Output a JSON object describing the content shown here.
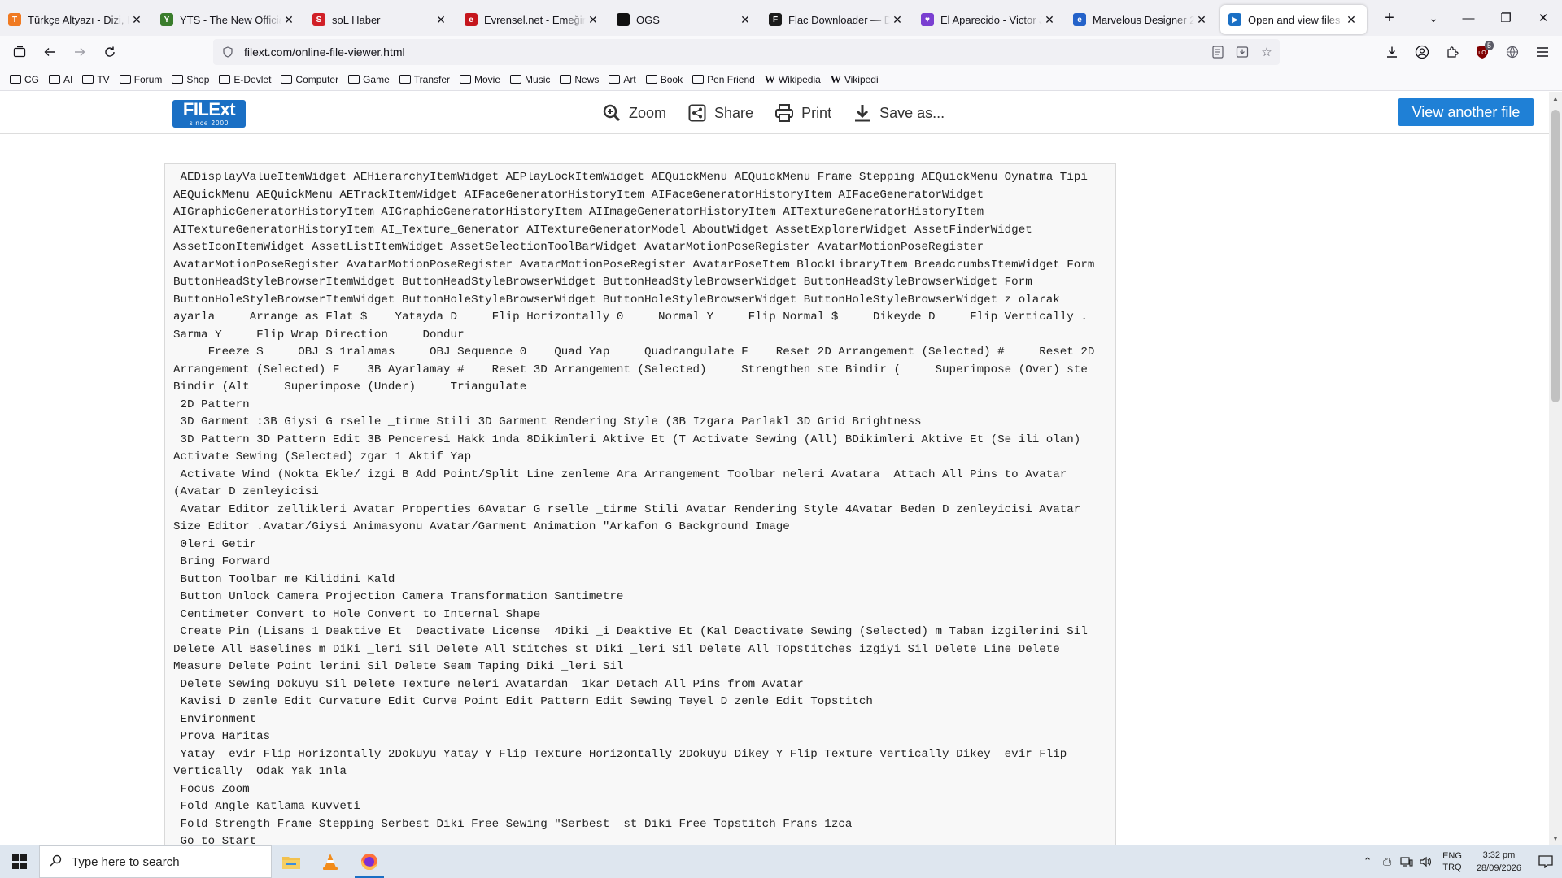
{
  "browser": {
    "tabs": [
      {
        "title": "Türkçe Altyazı - Dizi, Film",
        "favicon_letter": "T",
        "favicon_color": "#f07a22"
      },
      {
        "title": "YTS - The New Official H",
        "favicon_letter": "Y",
        "favicon_color": "#3a7d2c"
      },
      {
        "title": "soL Haber",
        "favicon_letter": "S",
        "favicon_color": "#d12027"
      },
      {
        "title": "Evrensel.net - Emeğin se",
        "favicon_letter": "e",
        "favicon_color": "#c5161d"
      },
      {
        "title": "OGS",
        "favicon_letter": "",
        "favicon_color": "#111111"
      },
      {
        "title": "Flac Downloader — Dow",
        "favicon_letter": "F",
        "favicon_color": "#1b1b1b"
      },
      {
        "title": "El Aparecido - Victor Jar",
        "favicon_letter": "♥",
        "favicon_color": "#7a3fd1"
      },
      {
        "title": "Marvelous Designer 202",
        "favicon_letter": "e",
        "favicon_color": "#2462c9"
      },
      {
        "title": "Open and view files onli",
        "favicon_letter": "▶",
        "favicon_color": "#1a6fc4"
      }
    ],
    "active_tab_index": 8,
    "url": "filext.com/online-file-viewer.html",
    "extension_badge": "5"
  },
  "bookmarks": [
    {
      "label": "CG",
      "type": "folder"
    },
    {
      "label": "AI",
      "type": "folder"
    },
    {
      "label": "TV",
      "type": "folder"
    },
    {
      "label": "Forum",
      "type": "folder"
    },
    {
      "label": "Shop",
      "type": "folder"
    },
    {
      "label": "E-Devlet",
      "type": "folder"
    },
    {
      "label": "Computer",
      "type": "folder"
    },
    {
      "label": "Game",
      "type": "folder"
    },
    {
      "label": "Transfer",
      "type": "folder"
    },
    {
      "label": "Movie",
      "type": "folder"
    },
    {
      "label": "Music",
      "type": "folder"
    },
    {
      "label": "News",
      "type": "folder"
    },
    {
      "label": "Art",
      "type": "folder"
    },
    {
      "label": "Book",
      "type": "folder"
    },
    {
      "label": "Pen Friend",
      "type": "folder"
    },
    {
      "label": "Wikipedia",
      "type": "wiki"
    },
    {
      "label": "Vikipedi",
      "type": "wiki"
    }
  ],
  "site": {
    "logo_text": "FILExt",
    "logo_sub": "since 2000",
    "toolbar": {
      "zoom": "Zoom",
      "share": "Share",
      "print": "Print",
      "save": "Save as..."
    },
    "view_another": "View another file"
  },
  "file_lines": [
    " AEDisplayValueItemWidget AEHierarchyItemWidget AEPlayLockItemWidget AEQuickMenu AEQuickMenu Frame Stepping AEQuickMenu Oynatma Tipi AEQuickMenu AEQuickMenu AETrackItemWidget AIFaceGeneratorHistoryItem AIFaceGeneratorHistoryItem AIFaceGeneratorWidget AIGraphicGeneratorHistoryItem AIGraphicGeneratorHistoryItem AIImageGeneratorHistoryItem AITextureGeneratorHistoryItem AITextureGeneratorHistoryItem AI_Texture_Generator AITextureGeneratorModel AboutWidget AssetExplorerWidget AssetFinderWidget AssetIconItemWidget AssetListItemWidget AssetSelectionToolBarWidget AvatarMotionPoseRegister AvatarMotionPoseRegister AvatarMotionPoseRegister AvatarMotionPoseRegister AvatarMotionPoseRegister AvatarPoseItem BlockLibraryItem BreadcrumbsItemWidget Form  ButtonHeadStyleBrowserItemWidget ButtonHeadStyleBrowserWidget ButtonHeadStyleBrowserWidget ButtonHeadStyleBrowserWidget Form ButtonHoleStyleBrowserItemWidget ButtonHoleStyleBrowserWidget ButtonHoleStyleBrowserWidget ButtonHoleStyleBrowserWidget z olarak ayarla     Arrange as Flat $    Yatayda D     Flip Horizontally 0     Normal Y     Flip Normal $     Dikeyde D     Flip Vertically . Sarma Y     Flip Wrap Direction     Dondur",
    "     Freeze $     OBJ S 1ralamas     OBJ Sequence 0    Quad Yap     Quadrangulate F    Reset 2D Arrangement (Selected) #     Reset 2D Arrangement (Selected) F    3B Ayarlamay #    Reset 3D Arrangement (Selected)     Strengthen ste Bindir (     Superimpose (Over) ste Bindir (Alt     Superimpose (Under)     Triangulate",
    " 2D Pattern",
    " 3D Garment :3B Giysi G rselle _tirme Stili 3D Garment Rendering Style (3B Izgara Parlakl 3D Grid Brightness",
    " 3D Pattern 3D Pattern Edit 3B Penceresi Hakk 1nda 8Dikimleri Aktive Et (T Activate Sewing (All) BDikimleri Aktive Et (Se ili olan) Activate Sewing (Selected) zgar 1 Aktif Yap",
    " Activate Wind (Nokta Ekle/ izgi B Add Point/Split Line zenleme Ara Arrangement Toolbar neleri Avatara  Attach All Pins to Avatar (Avatar D zenleyicisi",
    " Avatar Editor zellikleri Avatar Properties 6Avatar G rselle _tirme Stili Avatar Rendering Style 4Avatar Beden D zenleyicisi Avatar Size Editor .Avatar/Giysi Animasyonu Avatar/Garment Animation \"Arkafon G Background Image",
    " 0leri Getir",
    " Bring Forward",
    " Button Toolbar me Kilidini Kald",
    " Button Unlock Camera Projection Camera Transformation Santimetre",
    " Centimeter Convert to Hole Convert to Internal Shape",
    " Create Pin (Lisans 1 Deaktive Et  Deactivate License  4Diki _i Deaktive Et (Kal Deactivate Sewing (Selected) m Taban izgilerini Sil Delete All Baselines m Diki _leri Sil Delete All Stitches st Diki _leri Sil Delete All Topstitches izgiyi Sil Delete Line Delete Measure Delete Point lerini Sil Delete Seam Taping Diki _leri Sil",
    " Delete Sewing Dokuyu Sil Delete Texture neleri Avatardan  1kar Detach All Pins from Avatar",
    " Kavisi D zenle Edit Curvature Edit Curve Point Edit Pattern Edit Sewing Teyel D zenle Edit Topstitch",
    " Environment",
    " Prova Haritas",
    " Yatay  evir Flip Horizontally 2Dokuyu Yatay Y Flip Texture Horizontally 2Dokuyu Dikey Y Flip Texture Vertically Dikey  evir Flip Vertically  Odak Yak 1nla",
    " Focus Zoom",
    " Fold Angle Katlama Kuvveti",
    " Fold Strength Frame Stepping Serbest Diki Free Sewing \"Serbest  st Diki Free Topstitch Frans 1zca",
    " Go to Start"
  ],
  "taskbar": {
    "search_placeholder": "Type here to search",
    "lang_top": "ENG",
    "lang_bottom": "TRQ",
    "time": "3:32 pm",
    "date": "28/09/2026"
  }
}
